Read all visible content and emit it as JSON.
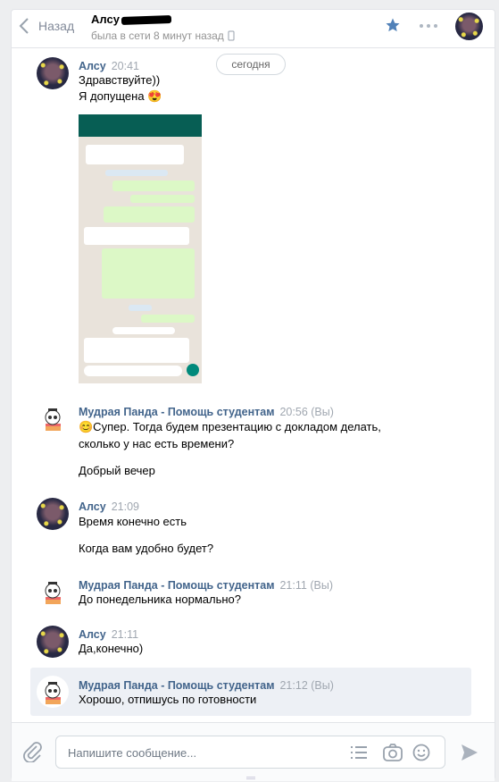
{
  "header": {
    "back_label": "Назад",
    "contact_name": "Алсу",
    "status": "была в сети 8 минут назад"
  },
  "date_divider": "сегодня",
  "messages": [
    {
      "author": "Алсу",
      "time": "20:41",
      "lines": [
        "Здравствуйте))",
        "Я допущена 😍"
      ]
    },
    {
      "author": "Мудрая Панда - Помощь студентам",
      "time": "20:56",
      "you": "(Вы)",
      "lines": [
        "😊Супер. Тогда будем презентацию с докладом делать,",
        "сколько у нас есть времени?",
        "Добрый вечер"
      ]
    },
    {
      "author": "Алсу",
      "time": "21:09",
      "lines": [
        "Время конечно есть",
        "Когда вам удобно будет?"
      ]
    },
    {
      "author": "Мудрая Панда - Помощь студентам",
      "time": "21:11",
      "you": "(Вы)",
      "lines": [
        "До понедельника нормально?"
      ]
    },
    {
      "author": "Алсу",
      "time": "21:11",
      "lines": [
        "Да,конечно)"
      ]
    },
    {
      "author": "Мудрая Панда - Помощь студентам",
      "time": "21:12",
      "you": "(Вы)",
      "lines": [
        "Хорошо, отпишусь по готовности"
      ]
    }
  ],
  "composer": {
    "placeholder": "Напишите сообщение..."
  },
  "colors": {
    "accent": "#5181b8",
    "link": "#42648b",
    "whatsapp": "#075e54"
  }
}
